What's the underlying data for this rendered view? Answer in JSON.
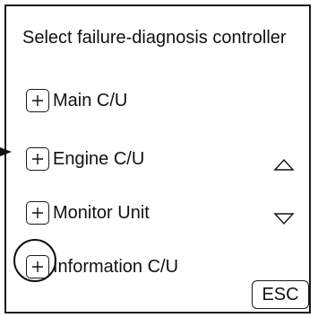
{
  "screen": {
    "title": "Select failure-diagnosis controller"
  },
  "menu": {
    "items": [
      {
        "label": "Main C/U",
        "icon": "plus-icon"
      },
      {
        "label": "Engine C/U",
        "icon": "plus-icon"
      },
      {
        "label": "Monitor Unit",
        "icon": "plus-icon"
      },
      {
        "label": "Information C/U",
        "icon": "plus-icon"
      }
    ]
  },
  "controls": {
    "scroll_up_icon": "triangle-up-icon",
    "scroll_down_icon": "triangle-down-icon",
    "esc_label": "ESC"
  },
  "colors": {
    "foreground": "#111111",
    "background": "#ffffff"
  }
}
